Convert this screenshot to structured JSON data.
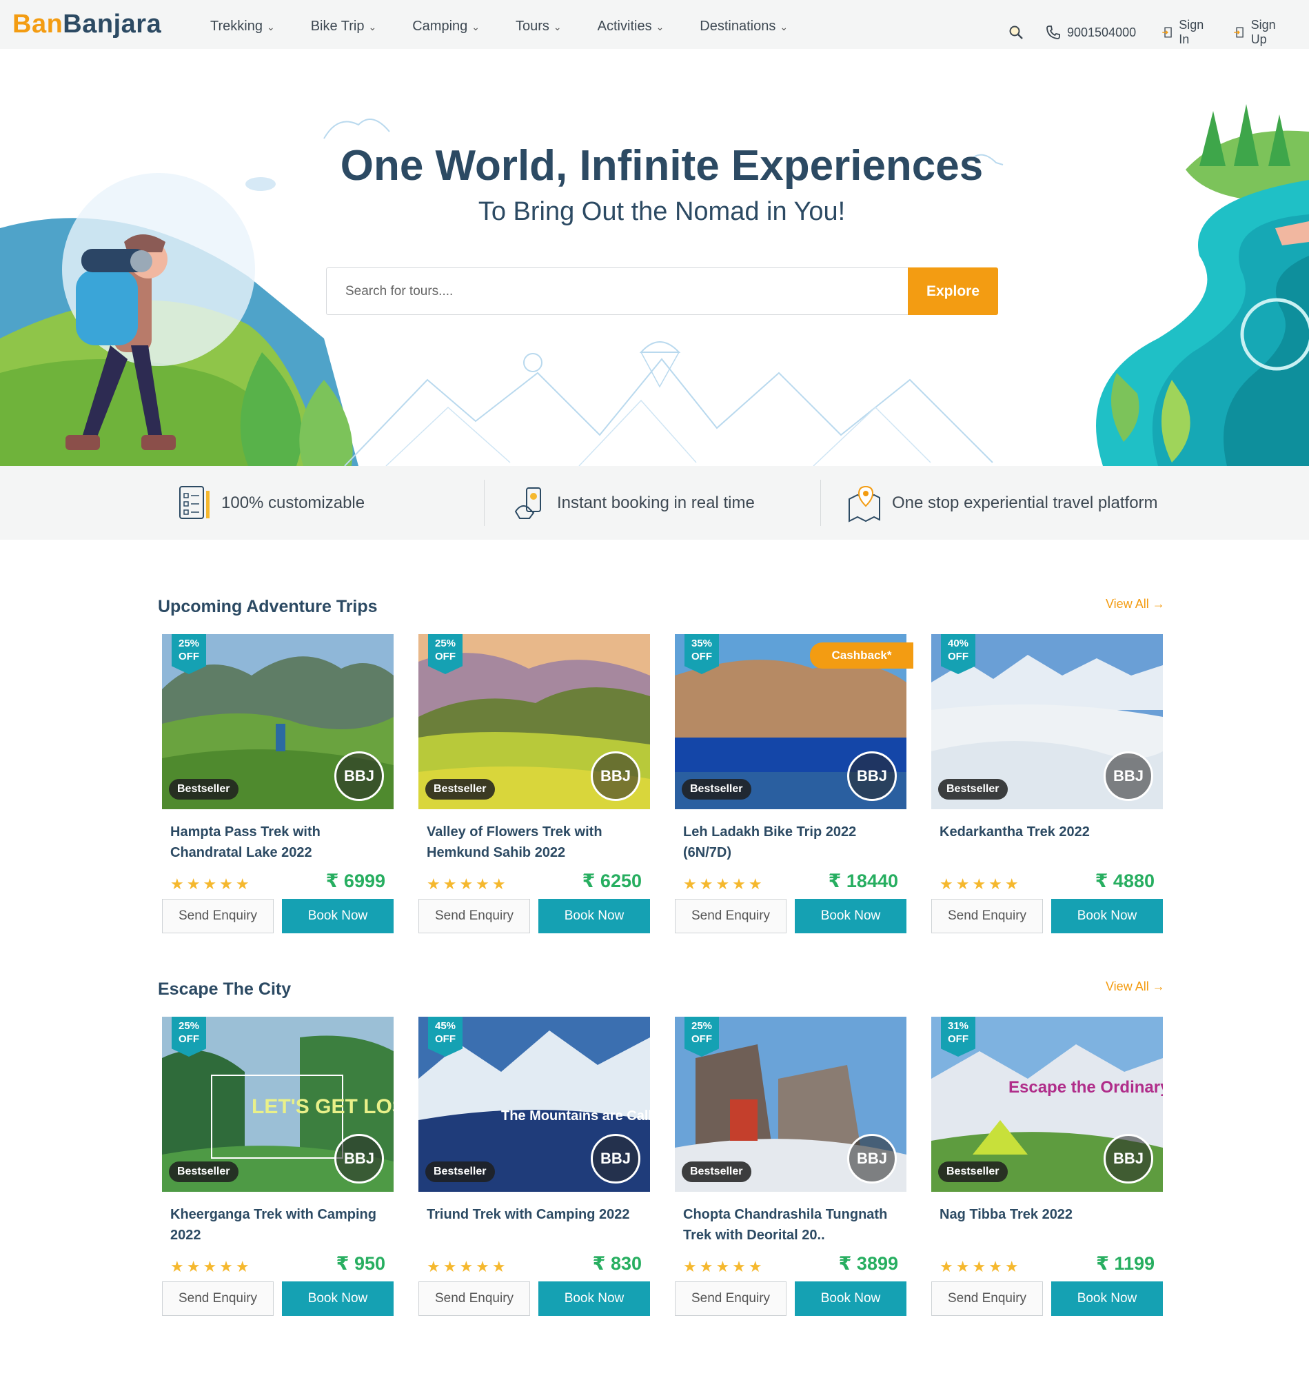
{
  "brand": {
    "part1": "Ban",
    "part2": "Banjara"
  },
  "nav": {
    "items": [
      {
        "label": "Trekking"
      },
      {
        "label": "Bike Trip"
      },
      {
        "label": "Camping"
      },
      {
        "label": "Tours"
      },
      {
        "label": "Activities"
      },
      {
        "label": "Destinations"
      }
    ],
    "phone": "9001504000",
    "sign_in": "Sign In",
    "sign_up": "Sign Up"
  },
  "hero": {
    "title": "One World, Infinite Experiences",
    "subtitle": "To Bring Out the Nomad in You!",
    "search_placeholder": "Search for tours....",
    "explore_label": "Explore"
  },
  "features": [
    {
      "label": "100% customizable"
    },
    {
      "label": "Instant booking in real time"
    },
    {
      "label": "One stop experiential travel platform"
    }
  ],
  "sections": [
    {
      "title": "Upcoming Adventure Trips",
      "view_all": "View All →",
      "cards": [
        {
          "discount": "25%",
          "off": "OFF",
          "badge": "Bestseller",
          "bbj": "BBJ",
          "cashback": "",
          "title": "Hampta Pass Trek with Chandratal Lake 2022",
          "stars": "★★★★★",
          "price": "₹ 6999",
          "enquiry": "Send Enquiry",
          "book": "Book Now"
        },
        {
          "discount": "25%",
          "off": "OFF",
          "badge": "Bestseller",
          "bbj": "BBJ",
          "cashback": "",
          "title": "Valley of Flowers Trek with Hemkund Sahib 2022",
          "stars": "★★★★★",
          "price": "₹ 6250",
          "enquiry": "Send Enquiry",
          "book": "Book Now"
        },
        {
          "discount": "35%",
          "off": "OFF",
          "badge": "Bestseller",
          "bbj": "BBJ",
          "cashback": "Cashback*",
          "title": "Leh Ladakh Bike Trip 2022 (6N/7D)",
          "stars": "★★★★★",
          "price": "₹ 18440",
          "enquiry": "Send Enquiry",
          "book": "Book Now"
        },
        {
          "discount": "40%",
          "off": "OFF",
          "badge": "Bestseller",
          "bbj": "BBJ",
          "cashback": "",
          "title": "Kedarkantha Trek 2022",
          "stars": "★★★★★",
          "price": "₹ 4880",
          "enquiry": "Send Enquiry",
          "book": "Book Now"
        }
      ]
    },
    {
      "title": "Escape The City",
      "view_all": "View All →",
      "cards": [
        {
          "discount": "25%",
          "off": "OFF",
          "badge": "Bestseller",
          "bbj": "BBJ",
          "cashback": "",
          "img_text": "LET'S GET LOST",
          "title": "Kheerganga Trek with Camping 2022",
          "stars": "★★★★★",
          "price": "₹ 950",
          "enquiry": "Send Enquiry",
          "book": "Book Now"
        },
        {
          "discount": "45%",
          "off": "OFF",
          "badge": "Bestseller",
          "bbj": "BBJ",
          "cashback": "",
          "img_text": "The Mountains are Calling",
          "title": "Triund Trek with Camping 2022",
          "stars": "★★★★★",
          "price": "₹ 830",
          "enquiry": "Send Enquiry",
          "book": "Book Now"
        },
        {
          "discount": "25%",
          "off": "OFF",
          "badge": "Bestseller",
          "bbj": "BBJ",
          "cashback": "",
          "title": "Chopta Chandrashila Tungnath Trek with Deorital 20..",
          "stars": "★★★★★",
          "price": "₹ 3899",
          "enquiry": "Send Enquiry",
          "book": "Book Now"
        },
        {
          "discount": "31%",
          "off": "OFF",
          "badge": "Bestseller",
          "bbj": "BBJ",
          "cashback": "",
          "img_text": "Escape the Ordinary",
          "title": "Nag Tibba Trek 2022",
          "stars": "★★★★★",
          "price": "₹ 1199",
          "enquiry": "Send Enquiry",
          "book": "Book Now"
        }
      ]
    }
  ]
}
